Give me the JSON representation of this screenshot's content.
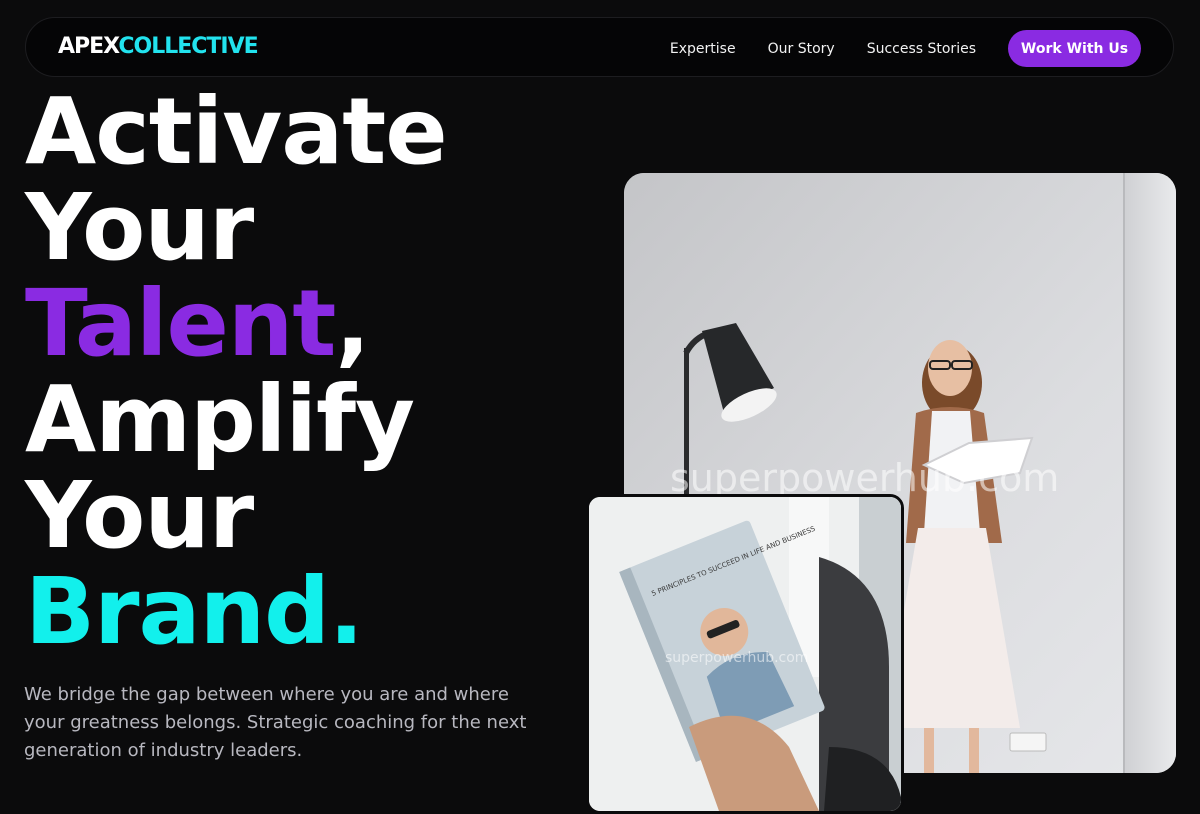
{
  "nav": {
    "logo_part1": "APEX",
    "logo_part2": "COLLECTIVE",
    "links": [
      "Expertise",
      "Our Story",
      "Success Stories"
    ],
    "cta": "Work With Us"
  },
  "hero": {
    "lines": [
      "Activate",
      "Your",
      "Talent",
      ",",
      "Amplify",
      "Your",
      "Brand."
    ],
    "subtitle": "We bridge the gap between where you are and where your greatness belongs. Strategic coaching for the next generation of industry leaders."
  },
  "images": {
    "main_watermark": "superpowerhub.com",
    "small_watermark": "superpowerhub.com",
    "book_text": "5 PRINCIPLES TO SUCCEED IN LIFE AND BUSINESS"
  },
  "colors": {
    "accent_purple": "#8a2be2",
    "accent_cyan": "#12f0ec",
    "background": "#0b0b0c"
  }
}
